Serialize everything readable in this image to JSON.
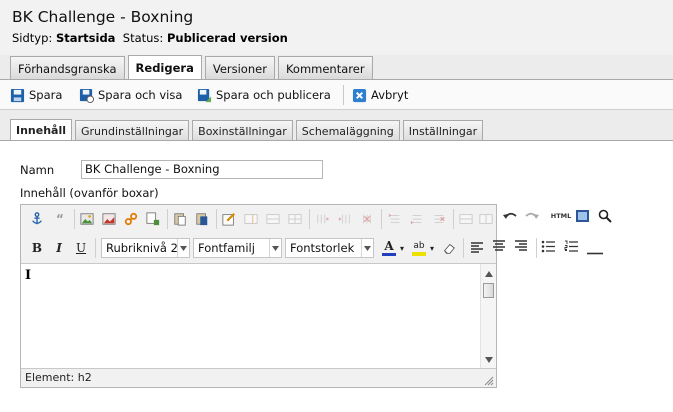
{
  "page": {
    "title": "BK Challenge - Boxning",
    "type_label": "Sidtyp:",
    "type_value": "Startsida",
    "status_label": "Status:",
    "status_value": "Publicerad version"
  },
  "main_tabs": [
    {
      "label": "Förhandsgranska",
      "active": false
    },
    {
      "label": "Redigera",
      "active": true
    },
    {
      "label": "Versioner",
      "active": false
    },
    {
      "label": "Kommentarer",
      "active": false
    }
  ],
  "toolbar": {
    "save": "Spara",
    "save_view": "Spara och visa",
    "save_publish": "Spara och publicera",
    "cancel": "Avbryt"
  },
  "sub_tabs": [
    {
      "label": "Innehåll",
      "active": true
    },
    {
      "label": "Grundinställningar",
      "active": false
    },
    {
      "label": "Boxinställningar",
      "active": false
    },
    {
      "label": "Schemaläggning",
      "active": false
    },
    {
      "label": "Inställningar",
      "active": false
    }
  ],
  "form": {
    "name_label": "Namn",
    "name_value": "BK Challenge - Boxning",
    "content_label": "Innehåll (ovanför boxar)"
  },
  "editor": {
    "heading_select": "Rubriknivå 2",
    "font_family_select": "Fontfamilj",
    "font_size_select": "Fontstorlek",
    "html_button": "HTML",
    "bold": "B",
    "italic": "I",
    "underline": "U",
    "text_color_letter": "A",
    "highlight_letters": "ab",
    "body_text": "I",
    "status": "Element: h2"
  },
  "colors": {
    "save_icon": "#1d5fa8",
    "cancel_icon": "#2f7fd0",
    "text_color_bar": "#1f3fbf",
    "highlight_bar": "#f0e000",
    "tab_border": "#a9a9a9"
  }
}
